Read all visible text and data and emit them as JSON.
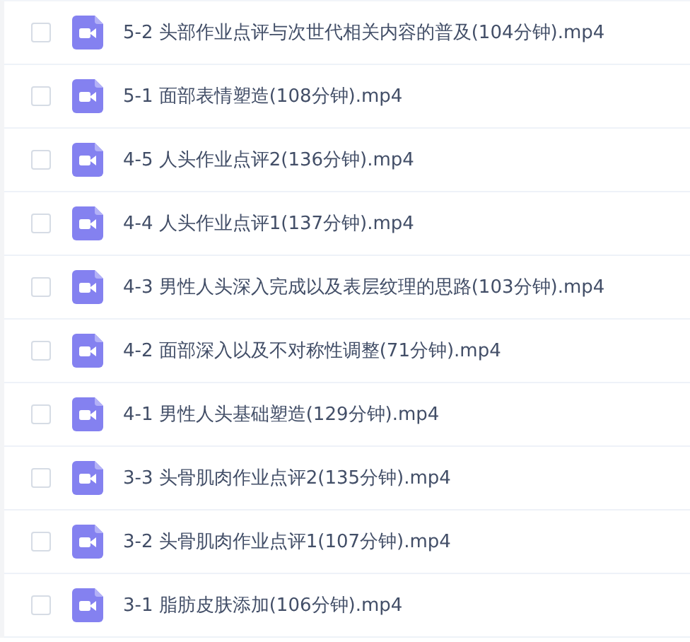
{
  "files": [
    {
      "name": "5-2 头部作业点评与次世代相关内容的普及(104分钟).mp4",
      "checked": false
    },
    {
      "name": "5-1 面部表情塑造(108分钟).mp4",
      "checked": false
    },
    {
      "name": "4-5 人头作业点评2(136分钟).mp4",
      "checked": false
    },
    {
      "name": "4-4 人头作业点评1(137分钟).mp4",
      "checked": false
    },
    {
      "name": "4-3 男性人头深入完成以及表层纹理的思路(103分钟).mp4",
      "checked": false
    },
    {
      "name": "4-2 面部深入以及不对称性调整(71分钟).mp4",
      "checked": false
    },
    {
      "name": "4-1 男性人头基础塑造(129分钟).mp4",
      "checked": false
    },
    {
      "name": "3-3 头骨肌肉作业点评2(135分钟).mp4",
      "checked": false
    },
    {
      "name": "3-2 头骨肌肉作业点评1(107分钟).mp4",
      "checked": false
    },
    {
      "name": "3-1 脂肪皮肤添加(106分钟).mp4",
      "checked": false
    }
  ]
}
